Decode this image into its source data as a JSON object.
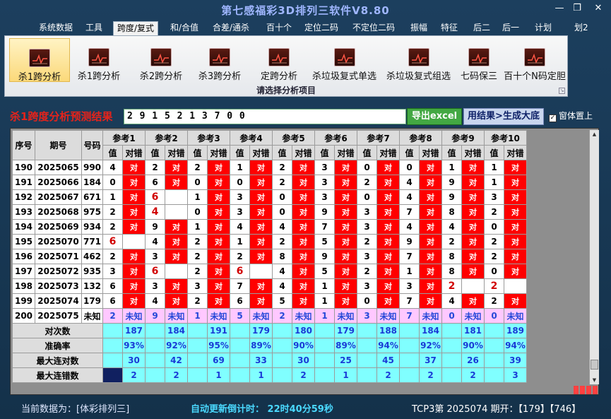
{
  "window": {
    "title": "第七感福彩3D排列三软件V8.80",
    "min_label": "—",
    "max_label": "❐",
    "close_label": "✕"
  },
  "menu": [
    "系统数据",
    "工具",
    "跨度/复式",
    "和/合值",
    "合差/通杀",
    "百十个",
    "定位二码",
    "不定位二码",
    "振幅",
    "特征",
    "后二",
    "后一",
    "计划",
    "划2"
  ],
  "menu_active": "跨度/复式",
  "ribbon": {
    "buttons": [
      "杀1跨分析",
      "杀1跨分析",
      "杀2跨分析",
      "杀3跨分析",
      "定跨分析",
      "杀垃圾复式单选",
      "杀垃圾复式组选",
      "七码保三",
      "百十个N码定胆"
    ],
    "selected_index": 0,
    "caption": "请选择分析项目"
  },
  "result": {
    "label": "杀1跨度分析预测结果",
    "value": "2 9 1 5 2 1 3 7 0 0",
    "excel_button": "导出excel",
    "generate_button": "用结果>生成大底",
    "topmost_label": "窗体置上",
    "topmost_checked": true
  },
  "table": {
    "head_fixed": [
      "序号",
      "期号",
      "号码"
    ],
    "groups": [
      "参考1",
      "参考2",
      "参考3",
      "参考4",
      "参考5",
      "参考6",
      "参考7",
      "参考8",
      "参考9",
      "参考10"
    ],
    "sub_value": "值",
    "sub_check": "对错",
    "check_mark": "对",
    "rows": [
      {
        "no": "190",
        "issue": "2025065",
        "num": "990",
        "cells": [
          [
            "4",
            1
          ],
          [
            "2",
            1
          ],
          [
            "2",
            1
          ],
          [
            "1",
            1
          ],
          [
            "2",
            1
          ],
          [
            "3",
            1
          ],
          [
            "0",
            1
          ],
          [
            "0",
            1
          ],
          [
            "1",
            1
          ],
          [
            "1",
            1
          ]
        ]
      },
      {
        "no": "191",
        "issue": "2025066",
        "num": "184",
        "cells": [
          [
            "0",
            1
          ],
          [
            "6",
            1
          ],
          [
            "0",
            1
          ],
          [
            "0",
            1
          ],
          [
            "2",
            1
          ],
          [
            "3",
            1
          ],
          [
            "2",
            1
          ],
          [
            "4",
            1
          ],
          [
            "9",
            1
          ],
          [
            "1",
            1
          ]
        ]
      },
      {
        "no": "192",
        "issue": "2025067",
        "num": "671",
        "cells": [
          [
            "1",
            1
          ],
          [
            "6",
            0
          ],
          [
            "1",
            1
          ],
          [
            "3",
            1
          ],
          [
            "0",
            1
          ],
          [
            "3",
            1
          ],
          [
            "0",
            1
          ],
          [
            "4",
            1
          ],
          [
            "9",
            1
          ],
          [
            "3",
            1
          ]
        ]
      },
      {
        "no": "193",
        "issue": "2025068",
        "num": "975",
        "cells": [
          [
            "2",
            1
          ],
          [
            "4",
            0
          ],
          [
            "0",
            1
          ],
          [
            "3",
            1
          ],
          [
            "0",
            1
          ],
          [
            "9",
            1
          ],
          [
            "3",
            1
          ],
          [
            "7",
            1
          ],
          [
            "8",
            1
          ],
          [
            "2",
            1
          ]
        ]
      },
      {
        "no": "194",
        "issue": "2025069",
        "num": "934",
        "cells": [
          [
            "2",
            1
          ],
          [
            "9",
            1
          ],
          [
            "1",
            1
          ],
          [
            "4",
            1
          ],
          [
            "4",
            1
          ],
          [
            "7",
            1
          ],
          [
            "3",
            1
          ],
          [
            "4",
            1
          ],
          [
            "4",
            1
          ],
          [
            "0",
            1
          ]
        ]
      },
      {
        "no": "195",
        "issue": "2025070",
        "num": "771",
        "cells": [
          [
            "6",
            0
          ],
          [
            "4",
            1
          ],
          [
            "2",
            1
          ],
          [
            "1",
            1
          ],
          [
            "2",
            1
          ],
          [
            "5",
            1
          ],
          [
            "2",
            1
          ],
          [
            "9",
            1
          ],
          [
            "2",
            1
          ],
          [
            "2",
            1
          ]
        ]
      },
      {
        "no": "196",
        "issue": "2025071",
        "num": "462",
        "cells": [
          [
            "2",
            1
          ],
          [
            "3",
            1
          ],
          [
            "2",
            1
          ],
          [
            "2",
            1
          ],
          [
            "8",
            1
          ],
          [
            "9",
            1
          ],
          [
            "3",
            1
          ],
          [
            "7",
            1
          ],
          [
            "8",
            1
          ],
          [
            "2",
            1
          ]
        ]
      },
      {
        "no": "197",
        "issue": "2025072",
        "num": "935",
        "cells": [
          [
            "3",
            1
          ],
          [
            "6",
            0
          ],
          [
            "2",
            1
          ],
          [
            "6",
            0
          ],
          [
            "4",
            1
          ],
          [
            "5",
            1
          ],
          [
            "2",
            1
          ],
          [
            "1",
            1
          ],
          [
            "8",
            1
          ],
          [
            "0",
            1
          ]
        ]
      },
      {
        "no": "198",
        "issue": "2025073",
        "num": "132",
        "cells": [
          [
            "6",
            1
          ],
          [
            "3",
            1
          ],
          [
            "3",
            1
          ],
          [
            "7",
            1
          ],
          [
            "4",
            1
          ],
          [
            "1",
            1
          ],
          [
            "3",
            1
          ],
          [
            "3",
            1
          ],
          [
            "2",
            0
          ],
          [
            "2",
            0
          ]
        ]
      },
      {
        "no": "199",
        "issue": "2025074",
        "num": "179",
        "cells": [
          [
            "6",
            1
          ],
          [
            "4",
            1
          ],
          [
            "2",
            1
          ],
          [
            "6",
            1
          ],
          [
            "5",
            1
          ],
          [
            "1",
            1
          ],
          [
            "0",
            1
          ],
          [
            "7",
            1
          ],
          [
            "4",
            1
          ],
          [
            "2",
            1
          ]
        ]
      }
    ],
    "pending": {
      "no": "200",
      "issue": "2025075",
      "num": "未知",
      "values": [
        "2",
        "9",
        "1",
        "5",
        "2",
        "1",
        "3",
        "7",
        "0",
        "0"
      ],
      "status": "未知"
    },
    "summary": [
      {
        "label": "对次数",
        "values": [
          "187",
          "184",
          "191",
          "179",
          "180",
          "179",
          "188",
          "184",
          "181",
          "189"
        ]
      },
      {
        "label": "准确率",
        "values": [
          "93%",
          "92%",
          "95%",
          "89%",
          "90%",
          "89%",
          "94%",
          "92%",
          "90%",
          "94%"
        ]
      },
      {
        "label": "最大连对数",
        "values": [
          "30",
          "42",
          "69",
          "33",
          "30",
          "25",
          "45",
          "37",
          "26",
          "39"
        ]
      },
      {
        "label": "最大连错数",
        "values": [
          "2",
          "2",
          "1",
          "1",
          "2",
          "1",
          "2",
          "2",
          "2",
          "3"
        ]
      }
    ]
  },
  "status": {
    "current": "当前数据为：[体彩排列三]",
    "countdown_label": "自动更新倒计时：",
    "countdown": "22时40分59秒",
    "draw": "TCP3第 2025074 期开：【179】【746】"
  },
  "colors": {
    "accent_red": "#ff0000",
    "summary_cyan": "#80ffff",
    "pending_pink": "#ffc8ff",
    "title_blue": "#9fb6ff"
  }
}
